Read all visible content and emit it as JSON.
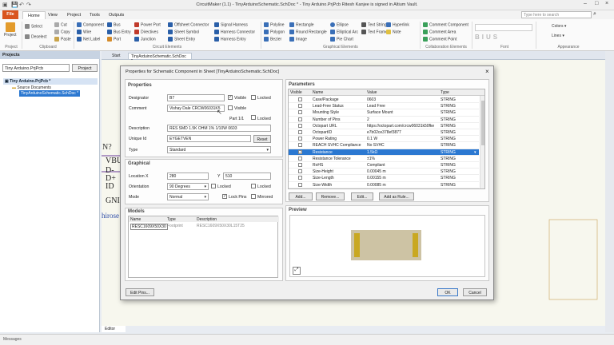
{
  "titlebar": {
    "title": "CircuitMaker (1.1) - TinyArduinoSchematic.SchDoc * - Tiny Arduino.PrjPcb Ritesh Kanjee is signed in Altium Vault."
  },
  "menu": {
    "file": "File",
    "tabs": [
      "Home",
      "View",
      "Project",
      "Tools",
      "Outputs"
    ]
  },
  "search": {
    "placeholder": "Type here to search"
  },
  "ribbon": {
    "project": "Project",
    "clipboard": [
      "Select",
      "Deselect",
      "Cut",
      "Copy",
      "Paste"
    ],
    "circuit": [
      "Component",
      "Wire",
      "Net Label",
      "Bus",
      "Bus Entry",
      "Port",
      "Power Port",
      "Directives",
      "Junction",
      "Offsheet Connector",
      "Sheet Symbol",
      "Sheet Entry",
      "Signal Harness",
      "Harness Connector",
      "Harness Entry"
    ],
    "graphical": [
      "Polyline",
      "Polygon",
      "Bezier",
      "Rectangle",
      "Round Rectangle",
      "Image",
      "Ellipse",
      "Elliptical Arc",
      "Pie Chart",
      "Text String",
      "Text Frame",
      "Note",
      "Hyperlink"
    ],
    "collab": [
      "Comment Component",
      "Comment Area",
      "Comment Point"
    ],
    "font": "BIUS",
    "appearance": [
      "Colors",
      "Lines"
    ],
    "groups": [
      "Project",
      "Clipboard",
      "Circuit Elements",
      "Graphical Elements",
      "Collaboration Elements",
      "Font",
      "Appearance"
    ]
  },
  "projects": {
    "header": "Projects",
    "search_value": "Tiny Arduino.PrjPcb",
    "project_btn": "Project",
    "tree": [
      "Tiny Arduino.PrjPcb *",
      "Source Documents",
      "TinyArduinoSchematic.SchDoc *"
    ]
  },
  "tabs": {
    "start": "Start",
    "doc": "TinyArduinoSchematic.SchDoc *"
  },
  "canvas": {
    "texts": [
      "N?",
      "VBU",
      "D-",
      "D+",
      "ID",
      "GNI",
      "hirose"
    ]
  },
  "editor": "Editor",
  "status": "Messages",
  "dialog": {
    "title": "Properties for Schematic Component in Sheet [TinyArduinoSchematic.SchDoc]",
    "properties_head": "Properties",
    "designator_lbl": "Designator",
    "designator_val": "B7",
    "visible1": "Visible",
    "locked1": "Locked",
    "comment_lbl": "Comment",
    "comment_val": "Vishay Dale CRCW06031K5",
    "visible2": "Visible",
    "part_lbl": "Part 1/1",
    "locked2": "Locked",
    "description_lbl": "Description",
    "description_val": "RES SMD 1.5K OHM 1% 1/10W 0603",
    "uniqueid_lbl": "Unique Id",
    "uniqueid_val": "EYGETVEN",
    "reset": "Reset",
    "type_lbl": "Type",
    "type_val": "Standard",
    "graphical_head": "Graphical",
    "location_lbl": "Location X",
    "x_val": "280",
    "y_lbl": "Y",
    "y_val": "510",
    "locked3": "Locked",
    "orientation_lbl": "Orientation",
    "orientation_val": "90 Degrees",
    "locked4": "Locked",
    "mode_lbl": "Mode",
    "mode_val": "Normal",
    "lockpins": "Lock Pins",
    "mirrored": "Mirrored",
    "models_head": "Models",
    "models_cols": [
      "Name",
      "Type",
      "Description"
    ],
    "models_row": [
      "RESC1609X50X30",
      "Footprint",
      "RESC1609X50X30L15T25"
    ],
    "params_head": "Parameters",
    "params_cols": [
      "Visible",
      "Name",
      "Value",
      "Type"
    ],
    "params": [
      [
        "Case/Package",
        "0603",
        "STRING"
      ],
      [
        "Lead-Free Status",
        "Lead Free",
        "STRING"
      ],
      [
        "Mounting Style",
        "Surface Mount",
        "STRING"
      ],
      [
        "Number of Pins",
        "2",
        "STRING"
      ],
      [
        "Octopart URL",
        "https://octopart.com/crcw06031k50fke",
        "STRING"
      ],
      [
        "OctopartID",
        "e7b02ce378ef3877",
        "STRING"
      ],
      [
        "Power Rating",
        "0.1 W",
        "STRING"
      ],
      [
        "REACH SVHC Compliance",
        "No SVHC",
        "STRING"
      ],
      [
        "Resistance",
        "1.5kΩ",
        "STRING"
      ],
      [
        "Resistance Tolerance",
        "±1%",
        "STRING"
      ],
      [
        "RoHS",
        "Compliant",
        "STRING"
      ],
      [
        "Size-Height",
        "0.00045 m",
        "STRING"
      ],
      [
        "Size-Length",
        "0.00155 m",
        "STRING"
      ],
      [
        "Size-Width",
        "0.00085 m",
        "STRING"
      ]
    ],
    "selected_row": 8,
    "btns": [
      "Add...",
      "Remove...",
      "Edit...",
      "Add as Rule..."
    ],
    "preview_head": "Preview",
    "editpins": "Edit Pins...",
    "ok": "OK",
    "cancel": "Cancel"
  }
}
